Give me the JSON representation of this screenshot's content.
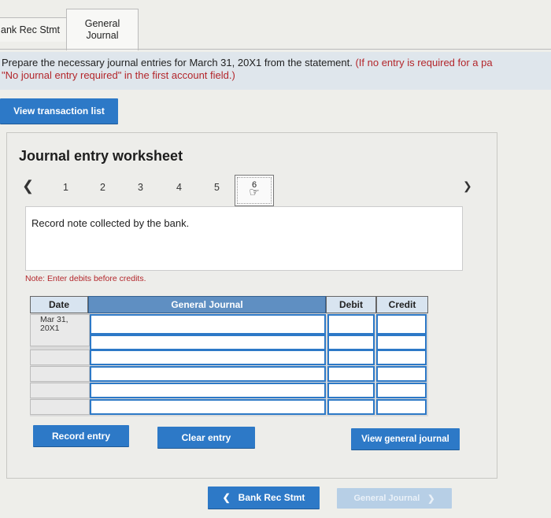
{
  "tabs": {
    "bank_rec": "ank Rec Stmt",
    "general_journal_line1": "General",
    "general_journal_line2": "Journal"
  },
  "instructions": {
    "main": "Prepare the necessary journal entries for March 31, 20X1 from the statement.",
    "red": "(If no entry is required for a pa",
    "line2": "\"No journal entry required\" in the first account field.)"
  },
  "buttons": {
    "view_transaction_list": "View transaction list",
    "record_entry": "Record entry",
    "clear_entry": "Clear entry",
    "view_general_journal": "View general journal",
    "bank_rec_stmt": "Bank Rec Stmt",
    "general_journal_next": "General Journal"
  },
  "worksheet": {
    "title": "Journal entry worksheet",
    "steps": [
      "1",
      "2",
      "3",
      "4",
      "5"
    ],
    "active_step": "6",
    "entry_description": "Record note collected by the bank.",
    "note": "Note: Enter debits before credits."
  },
  "journal_table": {
    "headers": {
      "date": "Date",
      "general_journal": "General Journal",
      "debit": "Debit",
      "credit": "Credit"
    },
    "first_date_line1": "Mar 31,",
    "first_date_line2": "20X1",
    "row_count": 6
  }
}
